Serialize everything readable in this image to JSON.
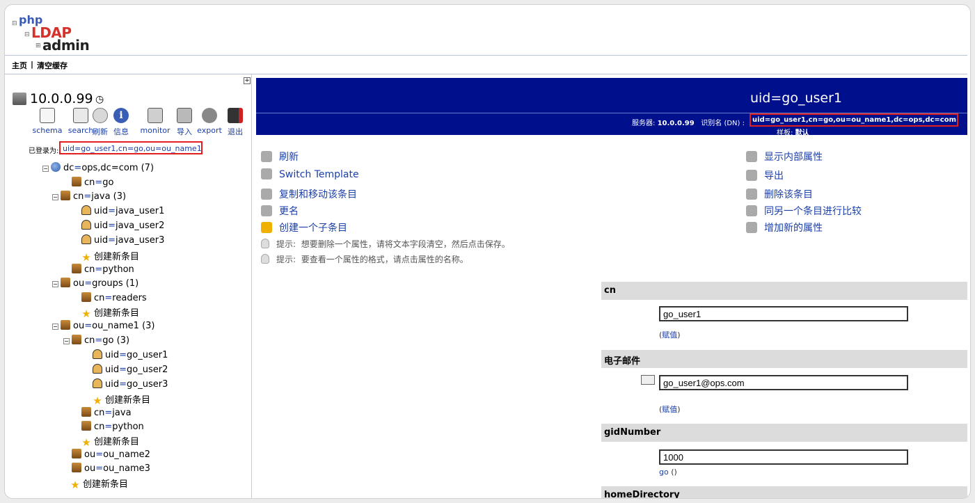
{
  "logo": {
    "php": "php",
    "ldap": "LDAP",
    "admin": "admin"
  },
  "topbar": {
    "home": "主页",
    "separator": "|",
    "clear_cache": "清空缓存"
  },
  "server": {
    "host": "10.0.0.99"
  },
  "toolbar": [
    {
      "icon": "schema-icon",
      "label": "schema"
    },
    {
      "icon": "search-icon",
      "label": "search"
    },
    {
      "icon": "refresh-icon",
      "label": "刷新"
    },
    {
      "icon": "info-icon",
      "label": "信息"
    },
    {
      "icon": "monitor-icon",
      "label": "monitor"
    },
    {
      "icon": "import-icon",
      "label": "导入"
    },
    {
      "icon": "export-icon",
      "label": "export"
    },
    {
      "icon": "logout-icon",
      "label": "退出"
    }
  ],
  "login": {
    "label": "已登录为:",
    "dn": "uid=go_user1,cn=go,ou=ou_name1"
  },
  "tree": [
    {
      "k": "dc",
      "v": "ops,dc=com (7)",
      "kind": "root"
    },
    {
      "k": "cn",
      "v": "go",
      "kind": "ou"
    },
    {
      "k": "cn",
      "v": "java (3)",
      "kind": "ou"
    },
    {
      "k": "uid",
      "v": "java_user1",
      "kind": "user"
    },
    {
      "k": "uid",
      "v": "java_user2",
      "kind": "user"
    },
    {
      "k": "uid",
      "v": "java_user3",
      "kind": "user"
    },
    {
      "k": "",
      "v": "创建新条目",
      "kind": "star"
    },
    {
      "k": "cn",
      "v": "python",
      "kind": "ou"
    },
    {
      "k": "ou",
      "v": "groups (1)",
      "kind": "ou"
    },
    {
      "k": "cn",
      "v": "readers",
      "kind": "ou"
    },
    {
      "k": "",
      "v": "创建新条目",
      "kind": "star"
    },
    {
      "k": "ou",
      "v": "ou_name1 (3)",
      "kind": "ou"
    },
    {
      "k": "cn",
      "v": "go (3)",
      "kind": "ou"
    },
    {
      "k": "uid",
      "v": "go_user1",
      "kind": "user"
    },
    {
      "k": "uid",
      "v": "go_user2",
      "kind": "user"
    },
    {
      "k": "uid",
      "v": "go_user3",
      "kind": "user"
    },
    {
      "k": "",
      "v": "创建新条目",
      "kind": "star"
    },
    {
      "k": "cn",
      "v": "java",
      "kind": "ou"
    },
    {
      "k": "cn",
      "v": "python",
      "kind": "ou"
    },
    {
      "k": "",
      "v": "创建新条目",
      "kind": "star"
    },
    {
      "k": "ou",
      "v": "ou_name2",
      "kind": "ou"
    },
    {
      "k": "ou",
      "v": "ou_name3",
      "kind": "ou"
    },
    {
      "k": "",
      "v": "创建新条目",
      "kind": "star"
    }
  ],
  "entry": {
    "title": "uid=go_user1",
    "server_label": "服务器:",
    "server_value": "10.0.0.99",
    "dn_label": "识别名 (DN) :",
    "dn_value": "uid=go_user1,cn=go,ou=ou_name1,dc=ops,dc=com",
    "template_label": "样板:",
    "template_value": "默认"
  },
  "actions_left": [
    {
      "icon": "refresh-icon",
      "label": "刷新"
    },
    {
      "icon": "switch-template-icon",
      "label": "Switch Template"
    },
    {
      "icon": "copy-move-icon",
      "label": "复制和移动该条目"
    },
    {
      "icon": "rename-icon",
      "label": "更名"
    },
    {
      "icon": "star-icon",
      "label": "创建一个子条目"
    }
  ],
  "actions_right": [
    {
      "icon": "tools-icon",
      "label": "显示内部属性"
    },
    {
      "icon": "export-icon",
      "label": "导出"
    },
    {
      "icon": "trash-icon",
      "label": "删除该条目"
    },
    {
      "icon": "compare-icon",
      "label": "同另一个条目进行比较"
    },
    {
      "icon": "add-attribute-icon",
      "label": "增加新的属性"
    }
  ],
  "hints": [
    {
      "label": "提示:",
      "text": "想要删除一个属性，请将文本字段清空，然后点击保存。"
    },
    {
      "label": "提示:",
      "text": "要查看一个属性的格式，请点击属性的名称。"
    }
  ],
  "attributes": [
    {
      "name": "cn",
      "value": "go_user1",
      "link_open": "(",
      "link": "赋值",
      "link_close": ")"
    },
    {
      "name": "电子邮件",
      "value": "go_user1@ops.com",
      "link_open": "(",
      "link": "赋值",
      "link_close": ")"
    },
    {
      "name": "gidNumber",
      "value": "1000",
      "link": "go",
      "link_close": " ()"
    },
    {
      "name": "homeDirectory"
    }
  ]
}
